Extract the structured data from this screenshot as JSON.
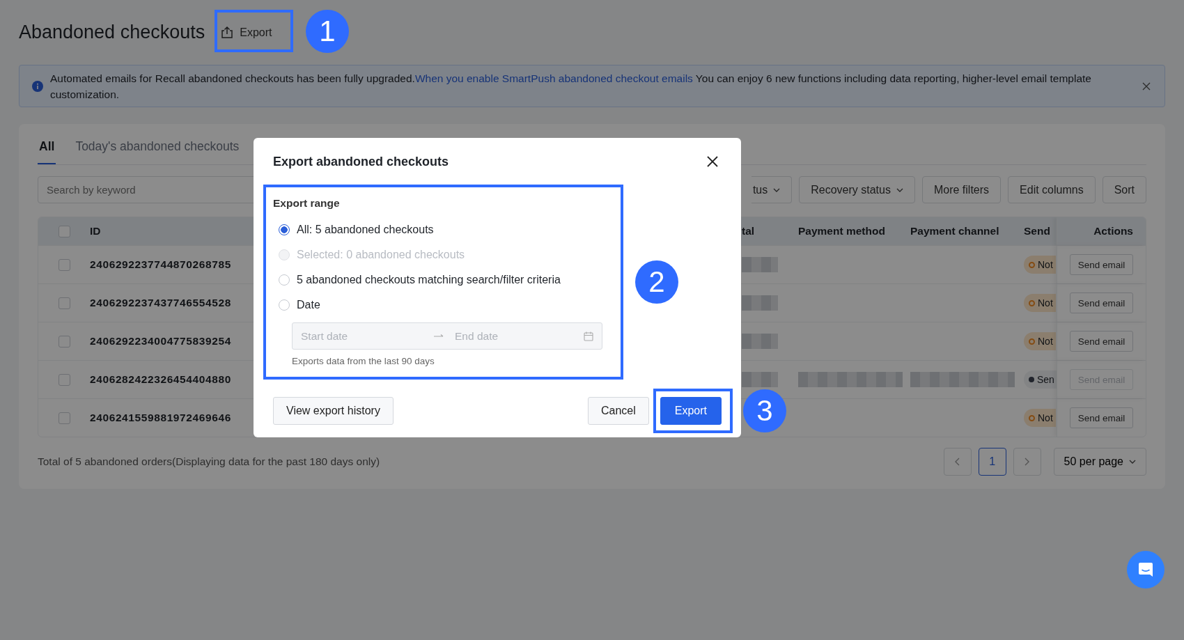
{
  "page": {
    "title": "Abandoned checkouts",
    "export_button": "Export"
  },
  "banner": {
    "text_before": "Automated emails for Recall abandoned checkouts has been fully upgraded.",
    "link": "When you enable SmartPush abandoned checkout emails",
    "text_after": " You can enjoy 6 new functions including data reporting, higher-level email template customization."
  },
  "tabs": [
    {
      "label": "All",
      "selected": true
    },
    {
      "label": "Today's abandoned checkouts",
      "selected": false
    }
  ],
  "search": {
    "placeholder": "Search by keyword"
  },
  "filters": [
    {
      "label": "tus",
      "dropdown": true
    },
    {
      "label": "Recovery status",
      "dropdown": true
    },
    {
      "label": "More filters",
      "dropdown": false
    },
    {
      "label": "Edit columns",
      "dropdown": false
    },
    {
      "label": "Sort",
      "dropdown": false
    }
  ],
  "table": {
    "header_checked": false,
    "columns": [
      "ID",
      "tal",
      "Payment method",
      "Payment channel",
      "Send",
      "Actions"
    ],
    "rows": [
      {
        "checked": false,
        "id": "2406292237744870268785",
        "redacted": {
          "total": true,
          "payment_method": false,
          "payment_channel": false
        },
        "status": {
          "label": "Not",
          "kind": "ring"
        },
        "action": {
          "label": "Send email",
          "disabled": false
        }
      },
      {
        "checked": false,
        "id": "2406292237437746554528",
        "redacted": {
          "total": true,
          "payment_method": false,
          "payment_channel": false
        },
        "status": {
          "label": "Not",
          "kind": "ring"
        },
        "action": {
          "label": "Send email",
          "disabled": false
        }
      },
      {
        "checked": false,
        "id": "2406292234004775839254",
        "redacted": {
          "total": true,
          "payment_method": false,
          "payment_channel": false
        },
        "status": {
          "label": "Not",
          "kind": "ring"
        },
        "action": {
          "label": "Send email",
          "disabled": false
        }
      },
      {
        "checked": false,
        "id": "2406282422326454404880",
        "redacted": {
          "total": true,
          "payment_method": true,
          "payment_channel": true
        },
        "status": {
          "label": "Sen",
          "kind": "dot"
        },
        "action": {
          "label": "Send email",
          "disabled": true
        }
      },
      {
        "checked": false,
        "id": "2406241559881972469646",
        "redacted": {
          "total": false,
          "payment_method": false,
          "payment_channel": false
        },
        "status": {
          "label": "Not",
          "kind": "ring"
        },
        "action": {
          "label": "Send email",
          "disabled": false
        }
      }
    ]
  },
  "footer": {
    "total_text": "Total of 5 abandoned orders(Displaying data for the past 180 days only)",
    "pages": [
      {
        "label": "1",
        "selected": true
      }
    ],
    "per_page": "50 per page"
  },
  "modal": {
    "title": "Export abandoned checkouts",
    "section_label": "Export range",
    "options": [
      {
        "label": "All: 5 abandoned checkouts",
        "selected": true,
        "disabled": false
      },
      {
        "label": "Selected: 0 abandoned checkouts",
        "selected": false,
        "disabled": true
      },
      {
        "label": "5 abandoned checkouts matching search/filter criteria",
        "selected": false,
        "disabled": false
      },
      {
        "label": "Date",
        "selected": false,
        "disabled": false
      }
    ],
    "date_range": {
      "start_placeholder": "Start date",
      "end_placeholder": "End date"
    },
    "hint": "Exports data from the last 90 days",
    "history_button": "View export history",
    "cancel_button": "Cancel",
    "export_button": "Export"
  },
  "annotations": [
    {
      "label": "1"
    },
    {
      "label": "2"
    },
    {
      "label": "3"
    }
  ]
}
